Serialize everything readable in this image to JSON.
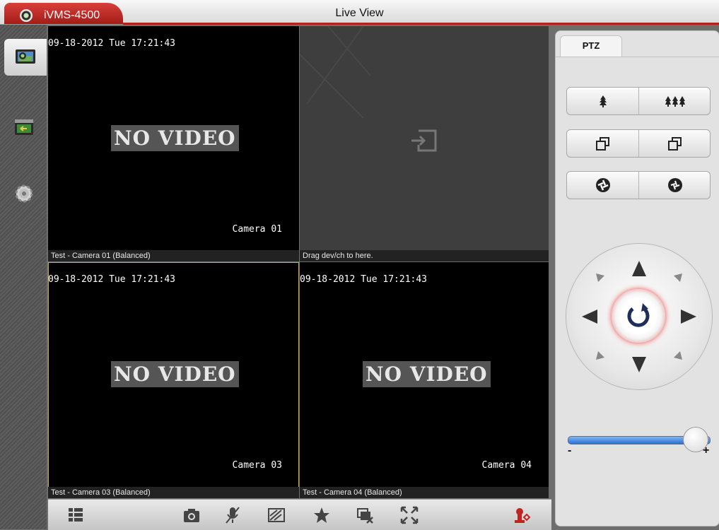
{
  "app": {
    "name": "iVMS-4500",
    "page_title": "Live View"
  },
  "sidebar": {
    "items": [
      {
        "name": "live-view",
        "icon": "camera-monitor-icon",
        "active": true
      },
      {
        "name": "playback",
        "icon": "playback-icon",
        "active": false
      },
      {
        "name": "settings",
        "icon": "gear-icon",
        "active": false
      }
    ]
  },
  "panes": [
    {
      "timestamp": "09-18-2012 Tue 17:21:43",
      "status": "NO VIDEO",
      "camera_osd": "Camera 01",
      "caption": "Test - Camera 01 (Balanced)"
    },
    {
      "caption": "Drag dev/ch to here.",
      "icon": "drop-here-icon"
    },
    {
      "timestamp": "09-18-2012 Tue 17:21:43",
      "status": "NO VIDEO",
      "camera_osd": "Camera 03",
      "caption": "Test - Camera 03 (Balanced)",
      "selected": true
    },
    {
      "timestamp": "09-18-2012 Tue 17:21:43",
      "status": "NO VIDEO",
      "camera_osd": "Camera 04",
      "caption": "Test - Camera 04 (Balanced)"
    }
  ],
  "toolbar": {
    "items": [
      "list-view-icon",
      "snapshot-icon",
      "mute-microphone-icon",
      "image-quality-icon",
      "favorite-icon",
      "close-all-icon",
      "fullscreen-icon",
      "ptz-control-icon"
    ]
  },
  "ptz": {
    "tab_label": "PTZ",
    "button_rows": [
      [
        "zoom-in-icon",
        "zoom-out-icon"
      ],
      [
        "focus-near-icon",
        "focus-far-icon"
      ],
      [
        "iris-open-icon",
        "iris-close-icon"
      ]
    ],
    "speed_min_label": "-",
    "speed_max_label": "+",
    "speed_level": 0.9
  },
  "colors": {
    "accent": "#b3231e",
    "slider": "#2d6fd0",
    "selected_border": "#d0a23a"
  }
}
